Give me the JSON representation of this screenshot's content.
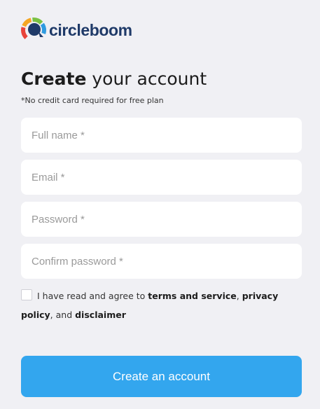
{
  "brand": {
    "name": "circleboom",
    "text_color": "#1f3a68",
    "ring_colors": [
      "#e8433a",
      "#f5a623",
      "#7ac143",
      "#2f9be0",
      "#1f3a68"
    ]
  },
  "heading": {
    "strong": "Create",
    "rest": " your account",
    "subtitle": "*No credit card required for free plan"
  },
  "form": {
    "full_name": {
      "placeholder": "Full name *",
      "value": ""
    },
    "email": {
      "placeholder": "Email *",
      "value": ""
    },
    "password": {
      "placeholder": "Password *",
      "value": ""
    },
    "confirm_password": {
      "placeholder": "Confirm password *",
      "value": ""
    }
  },
  "agreement": {
    "checked": false,
    "prefix": "I have read and agree to ",
    "terms": "terms and service",
    "sep1": ", ",
    "privacy": "privacy policy",
    "sep2": ", and ",
    "disclaimer": "disclaimer"
  },
  "submit": {
    "label": "Create an account",
    "color": "#33a6ee"
  },
  "background_color": "#f0f0f4"
}
